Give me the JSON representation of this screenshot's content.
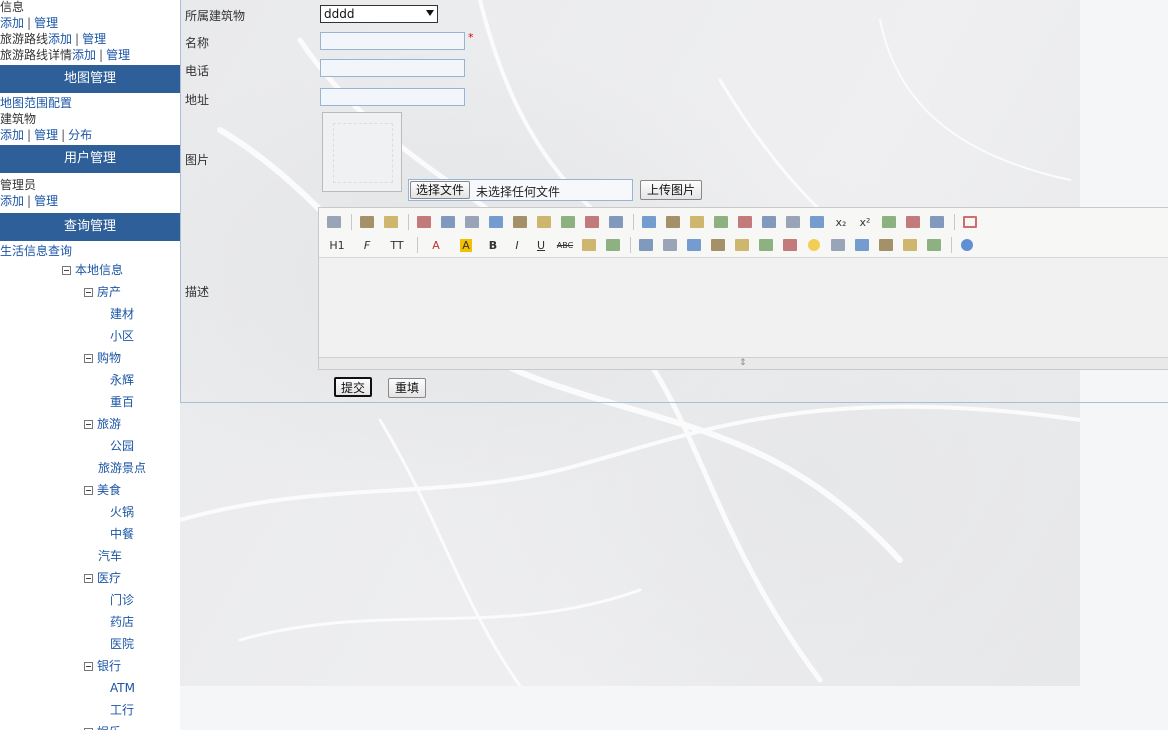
{
  "sidebar": {
    "info_line": "信息",
    "add": "添加",
    "manage": "管理",
    "distribution": "分布",
    "route_add_prefix": "旅游路线",
    "route_detail_prefix": "旅游路线详情",
    "map_header": "地图管理",
    "map_range": "地图范围配置",
    "building": "建筑物",
    "user_header": "用户管理",
    "admin": "管理员",
    "query_header": "查询管理",
    "life_query": "生活信息查询",
    "tree": [
      {
        "label": "本地信息",
        "level": 0,
        "toggle": true
      },
      {
        "label": "房产",
        "level": 1,
        "toggle": true
      },
      {
        "label": "建材",
        "level": 2,
        "toggle": false
      },
      {
        "label": "小区",
        "level": 2,
        "toggle": false
      },
      {
        "label": "购物",
        "level": 1,
        "toggle": true
      },
      {
        "label": "永辉",
        "level": 2,
        "toggle": false
      },
      {
        "label": "重百",
        "level": 2,
        "toggle": false
      },
      {
        "label": "旅游",
        "level": 1,
        "toggle": true
      },
      {
        "label": "公园",
        "level": 2,
        "toggle": false
      },
      {
        "label": "旅游景点",
        "level": 1.5,
        "toggle": false
      },
      {
        "label": "美食",
        "level": 1,
        "toggle": true
      },
      {
        "label": "火锅",
        "level": 2,
        "toggle": false
      },
      {
        "label": "中餐",
        "level": 2,
        "toggle": false
      },
      {
        "label": "汽车",
        "level": 1.5,
        "toggle": false
      },
      {
        "label": "医疗",
        "level": 1,
        "toggle": true
      },
      {
        "label": "门诊",
        "level": 2,
        "toggle": false
      },
      {
        "label": "药店",
        "level": 2,
        "toggle": false
      },
      {
        "label": "医院",
        "level": 2,
        "toggle": false
      },
      {
        "label": "银行",
        "level": 1,
        "toggle": true
      },
      {
        "label": "ATM",
        "level": 2,
        "toggle": false
      },
      {
        "label": "工行",
        "level": 2,
        "toggle": false
      },
      {
        "label": "娱乐",
        "level": 1,
        "toggle": true
      }
    ]
  },
  "form": {
    "building_label": "所属建筑物",
    "building_value": "dddd",
    "name_label": "名称",
    "name_value": "",
    "required_mark": "*",
    "phone_label": "电话",
    "phone_value": "",
    "address_label": "地址",
    "address_value": "",
    "image_label": "图片",
    "choose_file": "选择文件",
    "no_file": "未选择任何文件",
    "upload": "上传图片",
    "desc_label": "描述",
    "submit": "提交",
    "reset": "重填"
  },
  "editor": {
    "row1": [
      "source-icon",
      "sep",
      "undo-icon",
      "redo-icon",
      "sep",
      "preview-icon",
      "print-icon",
      "template-icon",
      "code-icon",
      "cut-icon",
      "copy-icon",
      "paste-icon",
      "paste-text-icon",
      "paste-word-icon",
      "sep",
      "align-left-icon",
      "align-center-icon",
      "align-right-icon",
      "justify-icon",
      "ordered-list-icon",
      "unordered-list-icon",
      "indent-icon",
      "outdent-icon",
      "subscript-icon",
      "superscript-icon",
      "clear-format-icon",
      "select-all-icon",
      "pointer-icon",
      "sep",
      "fullscreen-icon"
    ],
    "row2": [
      "heading-icon",
      "font-family-icon",
      "font-size-icon",
      "sep",
      "font-color-icon",
      "highlight-icon",
      "bold-icon",
      "italic-icon",
      "underline-icon",
      "strikethrough-icon",
      "line-height-icon",
      "eraser-icon",
      "sep",
      "image-icon",
      "multi-image-icon",
      "flash-icon",
      "media-icon",
      "attachment-icon",
      "table-icon",
      "hr-icon",
      "emoticon-icon",
      "map-icon",
      "pagebreak-icon",
      "anchor-icon",
      "link-icon",
      "unlink-icon",
      "sep",
      "help-icon"
    ],
    "labels": {
      "heading": "H1",
      "font_family": "F",
      "font_size": "TT",
      "font_color": "A",
      "highlight": "A",
      "bold": "B",
      "italic": "I",
      "underline": "U",
      "strike": "ABC",
      "sub": "x₂",
      "sup": "x²"
    }
  }
}
